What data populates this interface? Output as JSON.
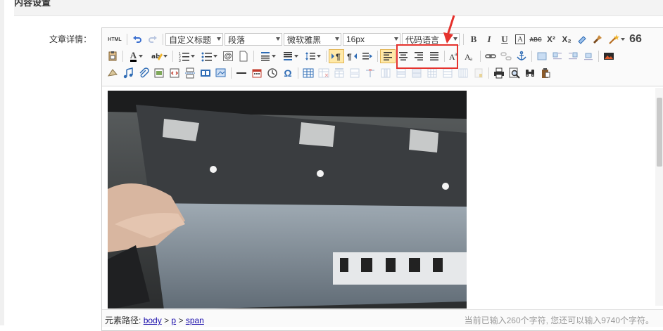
{
  "header": {
    "title": "内容设置"
  },
  "form": {
    "label": "文章详情："
  },
  "toolbar": {
    "html": "HTML",
    "heading": "自定义标题",
    "paragraph": "段落",
    "font": "微软雅黑",
    "size": "16px",
    "code": "代码语言",
    "bold": "B",
    "italic": "I",
    "underline": "U",
    "border_a": "A",
    "strike": "ABC",
    "sup": "X²",
    "sub": "X₂",
    "quote": "66",
    "omega": "Ω"
  },
  "statusbar": {
    "path_label": "元素路径:",
    "path": [
      "body",
      "p",
      "span"
    ],
    "sep": ">",
    "counter": "当前已输入260个字符, 您还可以输入9740个字符。"
  },
  "colors": {
    "highlight": "#e5322d",
    "link": "#1a0dab"
  }
}
